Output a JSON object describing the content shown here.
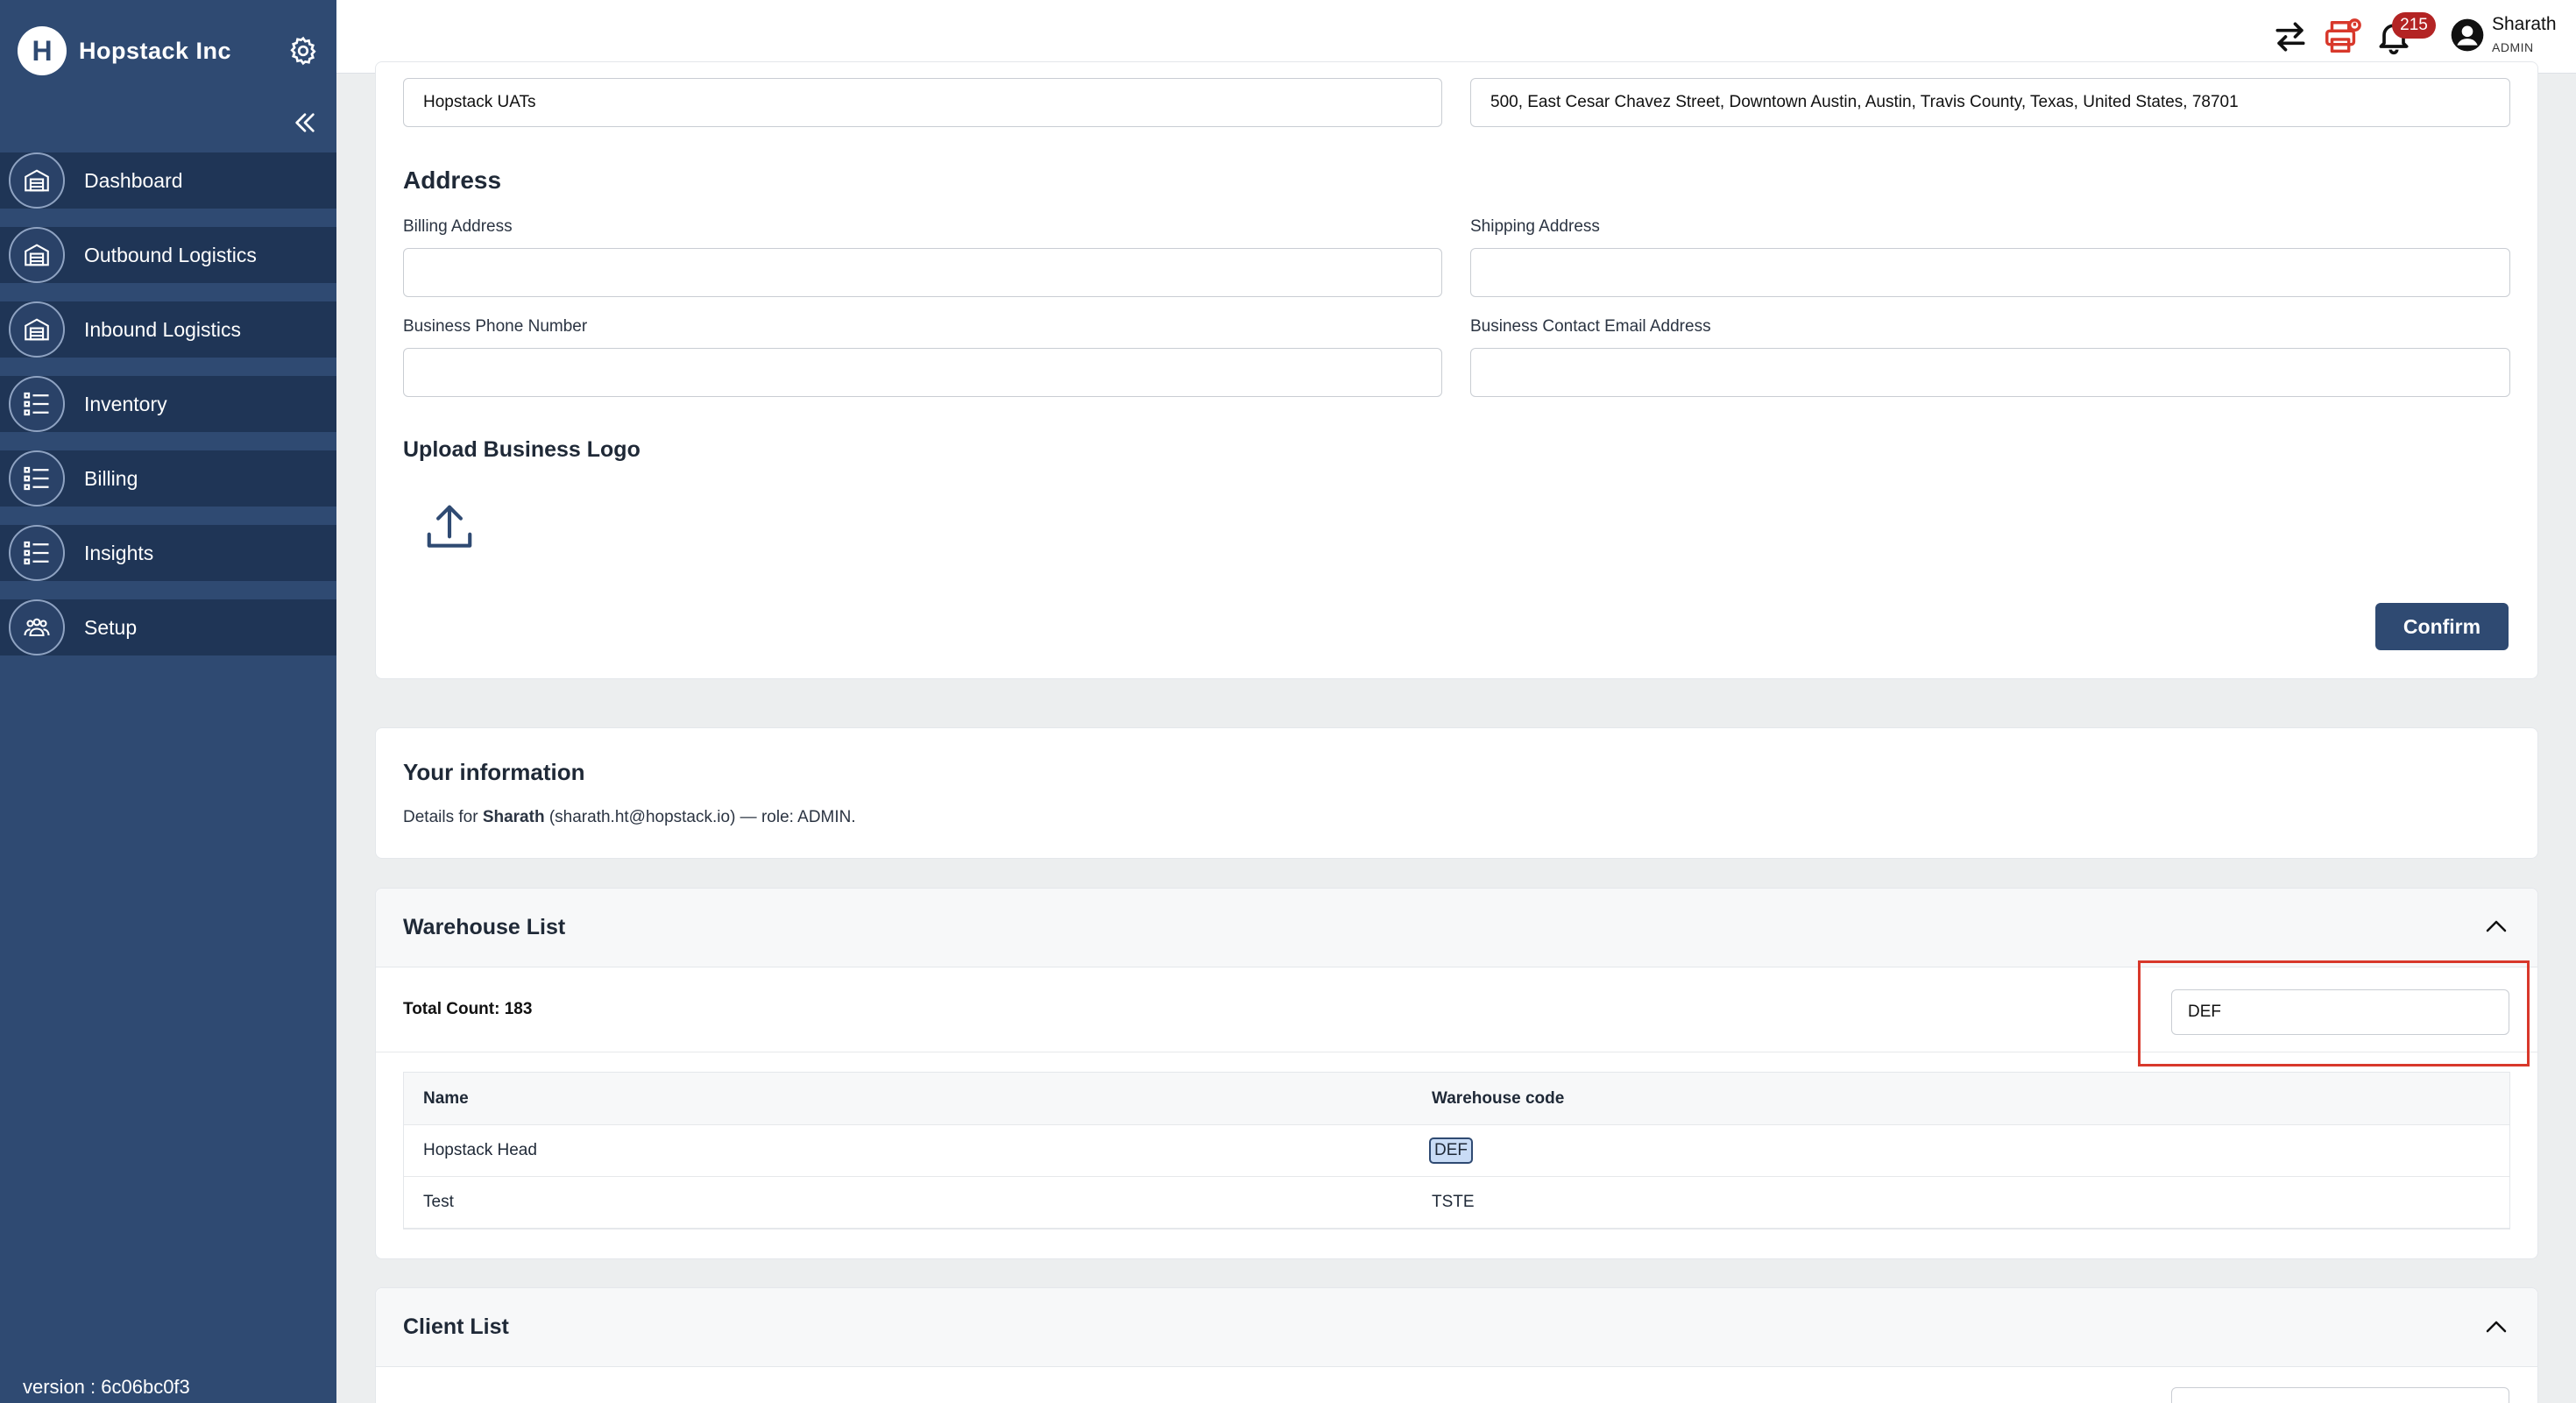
{
  "brand": {
    "name": "Hopstack Inc",
    "logo_letter": "H"
  },
  "sidebar": {
    "items": [
      {
        "label": "Dashboard",
        "icon": "warehouse-icon"
      },
      {
        "label": "Outbound Logistics",
        "icon": "warehouse-icon"
      },
      {
        "label": "Inbound Logistics",
        "icon": "warehouse-icon"
      },
      {
        "label": "Inventory",
        "icon": "checklist-icon"
      },
      {
        "label": "Billing",
        "icon": "checklist-icon"
      },
      {
        "label": "Insights",
        "icon": "checklist-icon"
      },
      {
        "label": "Setup",
        "icon": "team-icon"
      }
    ],
    "version": "version : 6c06bc0f3"
  },
  "header": {
    "notification_count": "215",
    "user_name": "Sharath",
    "user_role": "ADMIN"
  },
  "business": {
    "name_value": "Hopstack UATs",
    "address_value": "500, East Cesar Chavez Street, Downtown Austin, Austin, Travis County, Texas, United States, 78701",
    "address_title": "Address",
    "billing_label": "Billing Address",
    "billing_value": "",
    "shipping_label": "Shipping Address",
    "shipping_value": "",
    "phone_label": "Business Phone Number",
    "phone_value": "",
    "email_label": "Business Contact Email Address",
    "email_value": "",
    "upload_title": "Upload Business Logo",
    "confirm_label": "Confirm"
  },
  "your_info": {
    "title": "Your information",
    "prefix": "Details for ",
    "name": "Sharath",
    "suffix": " (sharath.ht@hopstack.io) — role: ADMIN."
  },
  "warehouse_list": {
    "title": "Warehouse List",
    "total_count": "Total Count: 183",
    "search_value": "DEF",
    "columns": [
      "Name",
      "Warehouse code"
    ],
    "rows": [
      {
        "name": "Hopstack Head",
        "code": "DEF"
      },
      {
        "name": "Test",
        "code": "TSTE"
      }
    ]
  },
  "client_list": {
    "title": "Client List"
  },
  "colors": {
    "sidebar_bg": "#2f4a72",
    "sidebar_item_bg": "#1f3556",
    "primary": "#2f4a72",
    "badge": "#b32424",
    "highlight_border": "#d8382b"
  }
}
